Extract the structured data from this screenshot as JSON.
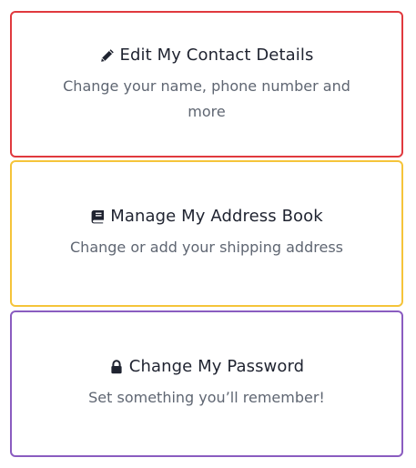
{
  "cards": [
    {
      "icon": "pencil-icon",
      "title": "Edit My Contact Details",
      "description": "Change your name, phone number and more",
      "border_color": "#e0393e"
    },
    {
      "icon": "book-icon",
      "title": "Manage My Address Book",
      "description": "Change or add your shipping address",
      "border_color": "#f5c43a"
    },
    {
      "icon": "lock-icon",
      "title": "Change My Password",
      "description": "Set something you’ll remember!",
      "border_color": "#8a5cc0"
    }
  ]
}
